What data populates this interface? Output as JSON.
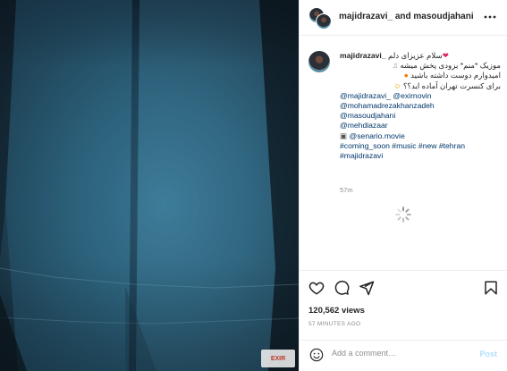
{
  "post": {
    "header_title": "majidrazavi_ and masoudjahani"
  },
  "caption": {
    "username": "majidrazavi_",
    "lines": [
      "سلام عزیزای دلم",
      "موزیک *منم* بزودی پخش میشه",
      "امیدوارم دوست داشته باشید",
      "برای کنسرت تهران آماده اید؟؟"
    ],
    "mentions": [
      "@majidrazavi_",
      "@exirnovin",
      "@mohamadrezakhanzadeh",
      "@masoudjahani",
      "@mehdiazaar",
      "@senario.movie"
    ],
    "hashtags": [
      "#coming_soon",
      "#music",
      "#new",
      "#tehran",
      "#majidrazavi"
    ],
    "time_ago": "57m"
  },
  "stats": {
    "views": "120,562 views",
    "posted": "57 MINUTES AGO"
  },
  "comment": {
    "placeholder": "Add a comment…",
    "post_label": "Post"
  },
  "watermark": {
    "brand": "EXIR"
  },
  "icons": {
    "more": "more-horizontal-icon",
    "like": "heart-icon",
    "comment": "comment-bubble-icon",
    "share": "paper-plane-icon",
    "save": "bookmark-icon",
    "emoji": "smiley-icon",
    "loading": "spinner-icon"
  },
  "colors": {
    "link": "#00376b",
    "muted": "#8e8e8e",
    "post_disabled": "#b2dffc",
    "heart_emoji": "#e0245e"
  }
}
